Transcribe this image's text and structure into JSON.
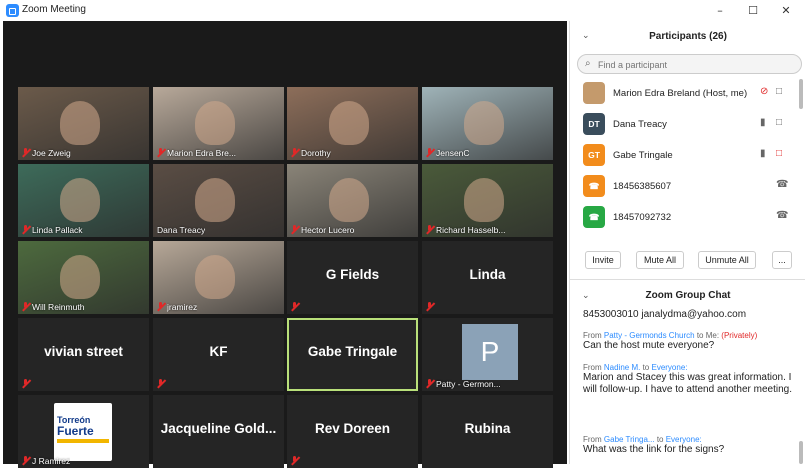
{
  "window": {
    "title": "Zoom Meeting",
    "minimize": "–",
    "maximize": "☐",
    "close": "✕"
  },
  "gallery": [
    {
      "name": "Joe Zweig",
      "type": "video",
      "bg": "#6b5a4a",
      "muted": true
    },
    {
      "name": "Marion Edra Bre...",
      "type": "video",
      "bg": "#b8a99a",
      "muted": true
    },
    {
      "name": "Dorothy",
      "type": "video",
      "bg": "#8d6e5a",
      "muted": true
    },
    {
      "name": "JensenC",
      "type": "video",
      "bg": "#9fb3b8",
      "muted": true
    },
    {
      "name": "Linda Pallack",
      "type": "video",
      "bg": "#3d6b5a",
      "muted": true
    },
    {
      "name": "Dana Treacy",
      "type": "video",
      "bg": "#5a4d44",
      "muted": false
    },
    {
      "name": "Hector Lucero",
      "type": "video",
      "bg": "#8a8478",
      "muted": true
    },
    {
      "name": "Richard Hasselb...",
      "type": "video",
      "bg": "#4a5a3a",
      "muted": true
    },
    {
      "name": "Will Reinmuth",
      "type": "video",
      "bg": "#4d6a3e",
      "muted": true
    },
    {
      "name": "jramirez",
      "type": "video",
      "bg": "#b7a898",
      "muted": true
    },
    {
      "name": "G Fields",
      "type": "name",
      "muted": true
    },
    {
      "name": "Linda",
      "type": "name",
      "muted": true
    },
    {
      "name": "vivian street",
      "type": "name",
      "muted": true
    },
    {
      "name": "KF",
      "type": "name",
      "muted": true
    },
    {
      "name": "Gabe Tringale",
      "type": "name",
      "muted": false,
      "active": true
    },
    {
      "name": "Patty - Germon...",
      "type": "avatar",
      "initial": "P",
      "muted": true
    },
    {
      "name": "J Ramirez",
      "type": "logo",
      "logo_line1": "Torreón",
      "logo_line2": "Fuerte",
      "muted": true
    },
    {
      "name": "Jacqueline  Gold...",
      "type": "name",
      "muted": false
    },
    {
      "name": "Rev Doreen",
      "type": "name",
      "muted": true
    },
    {
      "name": "Rubina",
      "type": "name",
      "muted": false
    }
  ],
  "participants_panel": {
    "title": "Participants (26)",
    "collapse_icon": "⌄",
    "search_placeholder": "Find a participant",
    "participants": [
      {
        "name": "Marion Edra Breland (Host, me)",
        "initials": "",
        "color": "#c49a6c",
        "mic": "muted",
        "video": "on"
      },
      {
        "name": "Dana Treacy",
        "initials": "DT",
        "color": "#3a4d5c",
        "mic": "on",
        "video": "on"
      },
      {
        "name": "Gabe Tringale",
        "initials": "GT",
        "color": "#f28c1c",
        "mic": "on",
        "video": "off"
      },
      {
        "name": "18456385607",
        "initials": "☎",
        "color": "#f28c1c",
        "mic": "",
        "video": "phone"
      },
      {
        "name": "18457092732",
        "initials": "☎",
        "color": "#27a844",
        "mic": "",
        "video": "phone"
      }
    ],
    "buttons": {
      "invite": "Invite",
      "mute_all": "Mute All",
      "unmute_all": "Unmute All",
      "more": "..."
    }
  },
  "chat_panel": {
    "title": "Zoom Group Chat",
    "collapse_icon": "⌄",
    "messages": [
      {
        "from": "",
        "to": "",
        "private": "",
        "text": "8453003010 janalydma@yahoo.com"
      },
      {
        "from": "Patty - Germonds Church",
        "to": "Me:",
        "private": "(Privately)",
        "text": "Can the host mute everyone?"
      },
      {
        "from": "Nadine M.",
        "to": "Everyone:",
        "private": "",
        "text": "Marion and Stacey this was great information.  I will follow-up.  I have to attend another meeting."
      },
      {
        "from": "Gabe Tringa...",
        "to": "Everyone:",
        "private": "",
        "text": "What was the link for the signs?"
      }
    ],
    "from_label": "From",
    "to_label": "to"
  }
}
